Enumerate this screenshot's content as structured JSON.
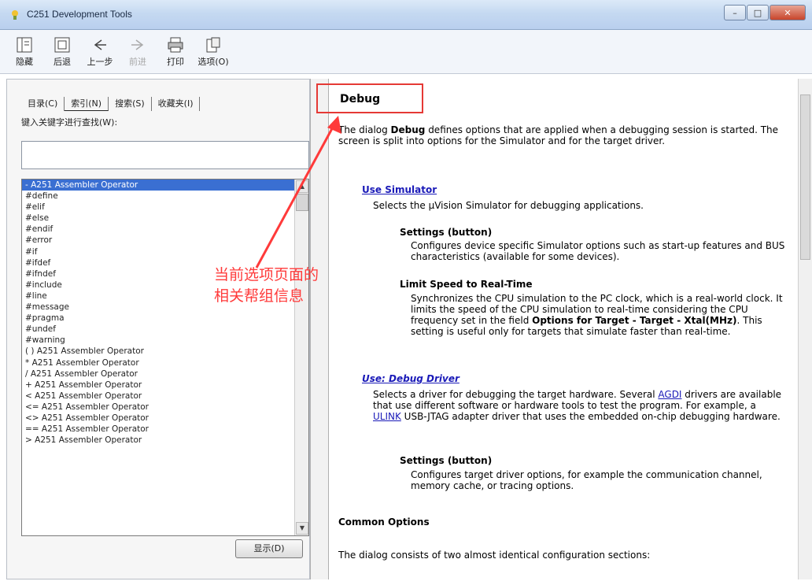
{
  "window": {
    "title": "C251 Development Tools",
    "minimize": "–",
    "maximize": "□",
    "close": "✕"
  },
  "toolbar": [
    {
      "label": "隐藏",
      "icon": "hide-icon",
      "enabled": true
    },
    {
      "label": "后退",
      "icon": "back-icon",
      "enabled": true
    },
    {
      "label": "上一步",
      "icon": "previous-icon",
      "enabled": true
    },
    {
      "label": "前进",
      "icon": "forward-icon",
      "enabled": false
    },
    {
      "label": "打印",
      "icon": "print-icon",
      "enabled": true
    },
    {
      "label": "选项(O)",
      "icon": "options-icon",
      "enabled": true
    }
  ],
  "left_pane": {
    "tabs": [
      "目录(C)",
      "索引(N)",
      "搜索(S)",
      "收藏夹(I)"
    ],
    "keyword_label": "键入关键字进行查找(W):",
    "keyword_value": "",
    "show_button": "显示(D)",
    "list_items": [
      "- A251 Assembler Operator",
      "#define",
      "#elif",
      "#else",
      "#endif",
      "#error",
      "#if",
      "#ifdef",
      "#ifndef",
      "#include",
      "#line",
      "#message",
      "#pragma",
      "#undef",
      "#warning",
      "( ) A251 Assembler Operator",
      "* A251 Assembler Operator",
      "/ A251 Assembler Operator",
      "+ A251 Assembler Operator",
      "< A251 Assembler Operator",
      "<= A251 Assembler Operator",
      "<> A251 Assembler Operator",
      "== A251 Assembler Operator",
      "> A251 Assembler Operator"
    ]
  },
  "content": {
    "title": "Debug",
    "intro_pre": "The dialog ",
    "intro_bold": "Debug",
    "intro_post": " defines options that are applied when a debugging session is started. The screen is split into options for the Simulator and for the target driver.",
    "use_simulator": "Use Simulator",
    "use_simulator_desc": "Selects the µVision Simulator for debugging applications.",
    "settings_button_1": "Settings (button)",
    "settings_desc_1": "Configures device specific Simulator options such as start-up features and BUS characteristics (available for some devices).",
    "limit_speed": "Limit Speed to Real-Time",
    "limit_speed_desc_1": "Synchronizes the CPU simulation to the PC clock, which is a real-world clock. It limits the speed of the CPU simulation to real-time considering the CPU frequency set in the field",
    "limit_speed_desc_bold": "Options for Target - Target - Xtal(MHz)",
    "limit_speed_desc_2": ". This setting is useful only for targets that simulate faster than real-time.",
    "use_debug_driver": "Use: Debug Driver",
    "driver_desc_1": "Selects a driver for debugging the target hardware. Several ",
    "driver_link_agdi": "AGDI",
    "driver_desc_2": " drivers are available that use different software or hardware tools to test the program. For example, a ",
    "driver_link_ulink": "ULINK",
    "driver_desc_3": " USB-JTAG adapter driver that uses the embedded on-chip debugging hardware.",
    "settings_button_2": "Settings (button)",
    "settings_desc_2": "Configures target driver options, for example the communication channel, memory cache, or tracing options.",
    "common_options": "Common Options",
    "common_desc": "The dialog consists of two almost identical configuration sections:"
  },
  "annotation": {
    "line1": "当前选项页面的",
    "line2": "相关帮组信息",
    "color": "#ff3a3a"
  }
}
